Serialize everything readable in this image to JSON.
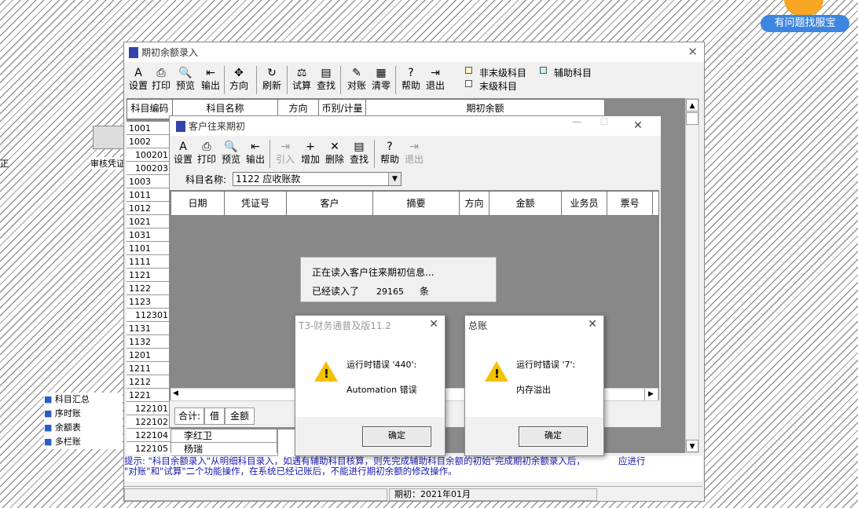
{
  "mascot": {
    "label": "有问题找服宝"
  },
  "desktop": {
    "audit_label": "审核凭证",
    "left_char": "正",
    "links": [
      "科目汇总",
      "序时账",
      "余额表",
      "多栏账"
    ]
  },
  "main_window": {
    "title": "期初余额录入",
    "toolbar": [
      {
        "label": "设置",
        "icon": "settings-icon",
        "glyph": "A"
      },
      {
        "label": "打印",
        "icon": "printer-icon",
        "glyph": "⎙"
      },
      {
        "label": "预览",
        "icon": "preview-icon",
        "glyph": "🔍"
      },
      {
        "label": "输出",
        "icon": "export-icon",
        "glyph": "⇤"
      },
      {
        "label": "方向",
        "icon": "direction-icon",
        "glyph": "✥"
      },
      {
        "label": "刷新",
        "icon": "refresh-icon",
        "glyph": "↻"
      },
      {
        "label": "试算",
        "icon": "balance-icon",
        "glyph": "⚖"
      },
      {
        "label": "查找",
        "icon": "find-icon",
        "glyph": "▤"
      },
      {
        "label": "对账",
        "icon": "reconcile-icon",
        "glyph": "✎"
      },
      {
        "label": "清零",
        "icon": "clear-icon",
        "glyph": "▦"
      },
      {
        "label": "帮助",
        "icon": "help-icon",
        "glyph": "?"
      },
      {
        "label": "退出",
        "icon": "exit-icon",
        "glyph": "⇥"
      }
    ],
    "legend": {
      "non_leaf": "非末级科目",
      "auxiliary": "辅助科目",
      "leaf": "末级科目"
    },
    "columns": [
      "科目编码",
      "科目名称",
      "方向",
      "币别/计量",
      "期初余额"
    ],
    "codes": [
      "1001",
      "1002",
      "100201",
      "100203",
      "1003",
      "1011",
      "1012",
      "1021",
      "1031",
      "1101",
      "1111",
      "1121",
      "1122",
      "1123",
      "112301",
      "1131",
      "1132",
      "1201",
      "1211",
      "1212",
      "1221",
      "122101",
      "122102",
      "122104",
      "122105"
    ],
    "names": {
      "122104": "李红卫",
      "122105": "杨瑞"
    },
    "hint": "提示: \"科目余额录入\"从明细科目录入，如遇有辅助科目核算，则先完成辅助科目余额的初始\"完成期初余额录入后，",
    "hint_end": "应进行",
    "hint2": "\"对账\"和\"试算\"二个功能操作，在系统已经记账后，不能进行期初余额的修改操作。",
    "status": "期初：2021年01月"
  },
  "customer_window": {
    "title": "客户往来期初",
    "toolbar": [
      {
        "label": "设置",
        "icon": "settings-icon",
        "glyph": "A",
        "enabled": true
      },
      {
        "label": "打印",
        "icon": "printer-icon",
        "glyph": "⎙",
        "enabled": true
      },
      {
        "label": "预览",
        "icon": "preview-icon",
        "glyph": "🔍",
        "enabled": true
      },
      {
        "label": "输出",
        "icon": "export-icon",
        "glyph": "⇤",
        "enabled": true
      },
      {
        "label": "引入",
        "icon": "import-icon",
        "glyph": "⇥",
        "enabled": false
      },
      {
        "label": "增加",
        "icon": "add-icon",
        "glyph": "+",
        "enabled": true
      },
      {
        "label": "删除",
        "icon": "delete-icon",
        "glyph": "✕",
        "enabled": true
      },
      {
        "label": "查找",
        "icon": "find-icon",
        "glyph": "▤",
        "enabled": true
      },
      {
        "label": "帮助",
        "icon": "help-icon",
        "glyph": "?",
        "enabled": true
      },
      {
        "label": "退出",
        "icon": "exit-icon",
        "glyph": "⇥",
        "enabled": false
      }
    ],
    "account_label": "科目名称:",
    "account_value": "1122 应收账款",
    "columns": [
      "日期",
      "凭证号",
      "客户",
      "摘要",
      "方向",
      "金额",
      "业务员",
      "票号"
    ],
    "footer": {
      "total_label": "合计:",
      "direction": "借",
      "amount_label": "金额"
    }
  },
  "progress": {
    "line1": "正在读入客户往来期初信息...",
    "line2_prefix": "已经读入了",
    "count": "29165",
    "line2_suffix": "条"
  },
  "dialog1": {
    "title": "T3-财务通普及版11.2",
    "line1": "运行时错误 '440':",
    "line2": "Automation 错误",
    "button": "确定"
  },
  "dialog2": {
    "title": "总账",
    "line1": "运行时错误 '7':",
    "line2": "内存溢出",
    "button": "确定"
  }
}
